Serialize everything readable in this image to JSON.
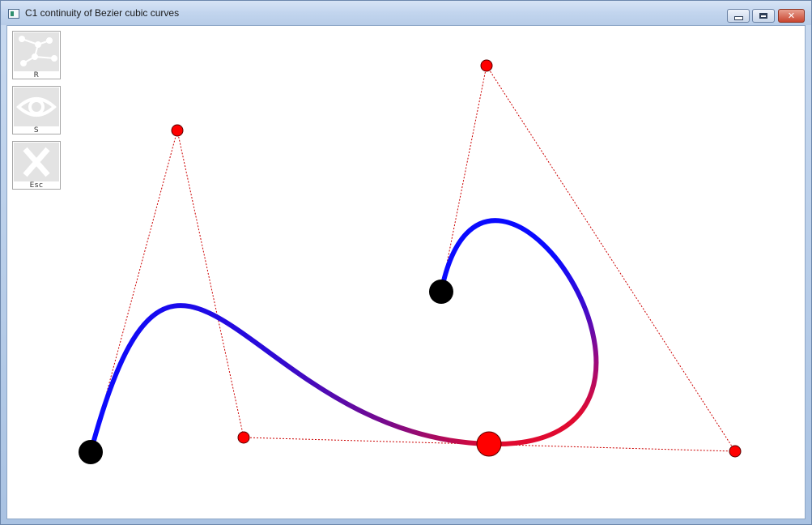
{
  "window": {
    "title": "C1 continuity of Bezier cubic curves",
    "controls": {
      "minimize": "minimize",
      "maximize": "maximize",
      "close": "✕"
    }
  },
  "toolbar": {
    "buttons": [
      {
        "key": "R",
        "icon": "random-points-icon"
      },
      {
        "key": "S",
        "icon": "eye-icon"
      },
      {
        "key": "Esc",
        "icon": "close-x-icon"
      }
    ]
  },
  "colors": {
    "curve_start": "#0000ff",
    "curve_end": "#e00020",
    "control_point": "#ff0000",
    "endpoint": "#000000",
    "control_polygon": "#cc0000"
  }
}
